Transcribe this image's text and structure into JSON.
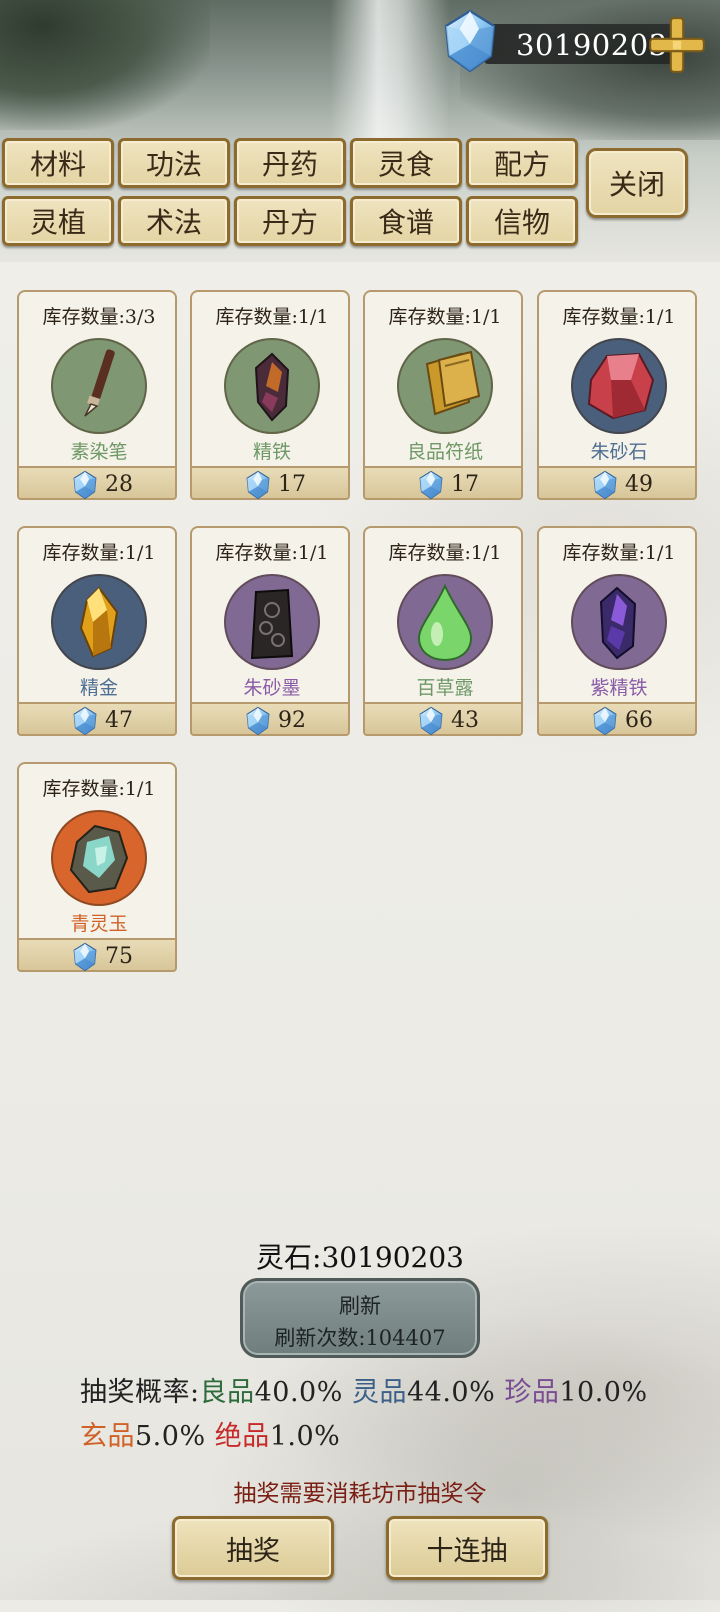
{
  "currency": {
    "amount": "30190203",
    "icon": "spirit-stone-icon",
    "add_icon": "plus-icon"
  },
  "tabs": {
    "row1": [
      "材料",
      "功法",
      "丹药",
      "灵食",
      "配方"
    ],
    "row2": [
      "灵植",
      "术法",
      "丹方",
      "食谱",
      "信物"
    ],
    "close": "关闭"
  },
  "items": [
    {
      "stock": "库存数量:3/3",
      "name": "素染笔",
      "price": "28",
      "icon": "brush-icon",
      "name_color": "#6e9866"
    },
    {
      "stock": "库存数量:1/1",
      "name": "精铁",
      "price": "17",
      "icon": "iron-ore-icon",
      "name_color": "#6e9866"
    },
    {
      "stock": "库存数量:1/1",
      "name": "良品符纸",
      "price": "17",
      "icon": "talisman-paper-icon",
      "name_color": "#6e9866"
    },
    {
      "stock": "库存数量:1/1",
      "name": "朱砂石",
      "price": "49",
      "icon": "cinnabar-icon",
      "name_color": "#4f6f92"
    },
    {
      "stock": "库存数量:1/1",
      "name": "精金",
      "price": "47",
      "icon": "gold-crystal-icon",
      "name_color": "#4f6f92"
    },
    {
      "stock": "库存数量:1/1",
      "name": "朱砂墨",
      "price": "92",
      "icon": "ink-stick-icon",
      "name_color": "#8a5ca6"
    },
    {
      "stock": "库存数量:1/1",
      "name": "百草露",
      "price": "43",
      "icon": "herb-dew-icon",
      "name_color": "#6e9866"
    },
    {
      "stock": "库存数量:1/1",
      "name": "紫精铁",
      "price": "66",
      "icon": "purple-iron-icon",
      "name_color": "#8a5ca6"
    },
    {
      "stock": "库存数量:1/1",
      "name": "青灵玉",
      "price": "75",
      "icon": "jade-ore-icon",
      "name_color": "#d06227"
    }
  ],
  "balance": "灵石:30190203",
  "refresh": {
    "label": "刷新",
    "count": "刷新次数:104407"
  },
  "odds": {
    "label": "抽奖概率:",
    "t1": "良品",
    "v1": "40.0%",
    "t2": "灵品",
    "v2": "44.0%",
    "t3": "珍品",
    "v3": "10.0%",
    "t4": "玄品",
    "v4": "5.0%",
    "t5": "绝品",
    "v5": "1.0%",
    "colors": {
      "t1": "#2e6b3a",
      "t2": "#3b5f88",
      "t3": "#7a4c94",
      "t4": "#d06227",
      "t5": "#c72a2a"
    }
  },
  "hint": "抽奖需要消耗坊市抽奖令",
  "buttons": {
    "draw": "抽奖",
    "draw_ten": "十连抽"
  }
}
